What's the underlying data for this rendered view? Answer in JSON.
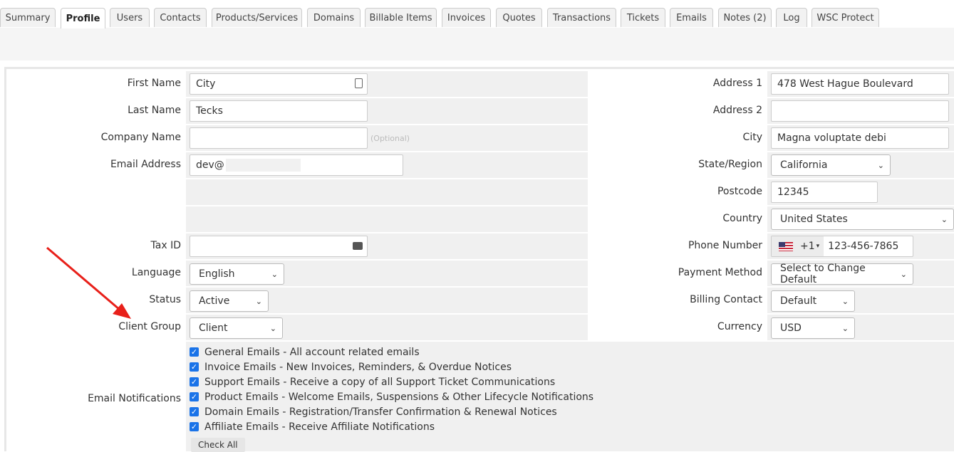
{
  "tabs": [
    "Summary",
    "Profile",
    "Users",
    "Contacts",
    "Products/Services",
    "Domains",
    "Billable Items",
    "Invoices",
    "Quotes",
    "Transactions",
    "Tickets",
    "Emails",
    "Notes (2)",
    "Log",
    "WSC Protect"
  ],
  "active_tab": "Profile",
  "form": {
    "first_name": {
      "label": "First Name",
      "value": "City"
    },
    "last_name": {
      "label": "Last Name",
      "value": "Tecks"
    },
    "company_name": {
      "label": "Company Name",
      "value": "",
      "hint": "(Optional)"
    },
    "email": {
      "label": "Email Address",
      "value": "dev@"
    },
    "tax_id": {
      "label": "Tax ID",
      "value": ""
    },
    "language": {
      "label": "Language",
      "value": "English"
    },
    "status": {
      "label": "Status",
      "value": "Active"
    },
    "client_group": {
      "label": "Client Group",
      "value": "Client"
    },
    "address1": {
      "label": "Address 1",
      "value": "478 West Hague Boulevard"
    },
    "address2": {
      "label": "Address 2",
      "value": ""
    },
    "city": {
      "label": "City",
      "value": "Magna voluptate debi"
    },
    "state": {
      "label": "State/Region",
      "value": "California"
    },
    "postcode": {
      "label": "Postcode",
      "value": "12345"
    },
    "country": {
      "label": "Country",
      "value": "United States"
    },
    "phone": {
      "label": "Phone Number",
      "code": "+1",
      "value": "123-456-7865"
    },
    "payment_method": {
      "label": "Payment Method",
      "value": "Select to Change Default"
    },
    "billing_contact": {
      "label": "Billing Contact",
      "value": "Default"
    },
    "currency": {
      "label": "Currency",
      "value": "USD"
    }
  },
  "email_notifications": {
    "label": "Email Notifications",
    "items": [
      "General Emails - All account related emails",
      "Invoice Emails - New Invoices, Reminders, & Overdue Notices",
      "Support Emails - Receive a copy of all Support Ticket Communications",
      "Product Emails - Welcome Emails, Suspensions & Other Lifecycle Notifications",
      "Domain Emails - Registration/Transfer Confirmation & Renewal Notices",
      "Affiliate Emails - Receive Affiliate Notifications"
    ],
    "check_all": "Check All"
  },
  "colors": {
    "accent": "#1a73e8",
    "arrow": "#e8201a"
  }
}
